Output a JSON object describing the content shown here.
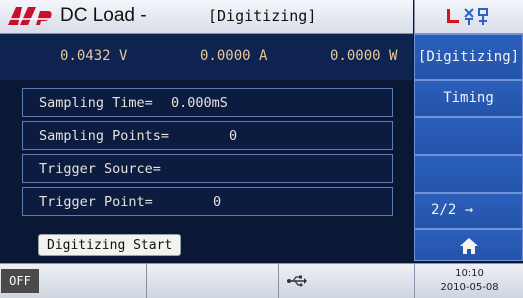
{
  "title": {
    "app": "DC Load -",
    "mode": "[Digitizing]"
  },
  "measurements": {
    "voltage": "0.0432 V",
    "current": "0.0000 A",
    "power": "0.0000 W"
  },
  "settings": [
    {
      "label": "Sampling Time=",
      "value": "0.000mS"
    },
    {
      "label": "Sampling Points=",
      "value": "0"
    },
    {
      "label": "Trigger Source=",
      "value": ""
    },
    {
      "label": "Trigger Point=",
      "value": "0"
    }
  ],
  "start_label": "Digitizing Start",
  "softkeys": {
    "k1": "[Digitizing]",
    "k2": "Timing",
    "k3": "",
    "k4": "",
    "k5": "2/2 →",
    "k6_icon": "home-icon"
  },
  "status": {
    "output": "OFF",
    "usb_icon": "usb-icon",
    "time": "10:10",
    "date": "2010-05-08"
  },
  "colors": {
    "accent": "#2b5fbc",
    "measurement_text": "#e8c898",
    "background": "#0a1735"
  }
}
